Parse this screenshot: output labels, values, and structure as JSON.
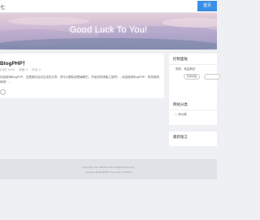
{
  "header": {
    "logo_text": "七",
    "nav_home": "首页"
  },
  "banner": {
    "title": "Good Luck To You!"
  },
  "post": {
    "title": "BlogPHP！",
    "meta": {
      "date": "8-8日 10:00",
      "views": "阅读: 0",
      "comments": "评论: 0"
    },
    "excerpt": "欢迎使用BlogPHP，这是程序自动生成的文章，您可以删除或是编辑它，开始您的博客之旅吧！...欢迎使用BlogPHP，祝您使用愉快！..."
  },
  "sidebar": {
    "control": {
      "title": "控制面板",
      "welcome": "您好，欢迎到访",
      "login_label": "登录管理"
    },
    "categories": {
      "title": "网站分类",
      "items": [
        "未分类"
      ]
    },
    "comments": {
      "title": "最新留言"
    }
  },
  "footer": {
    "line1": "Copyright Your WebSite.Some Rights Reserved.",
    "line2": "Powered By BlogPHP Theme By TOYEAN"
  },
  "colors": {
    "accent": "#3a8ee6",
    "background": "#eef0f3"
  }
}
